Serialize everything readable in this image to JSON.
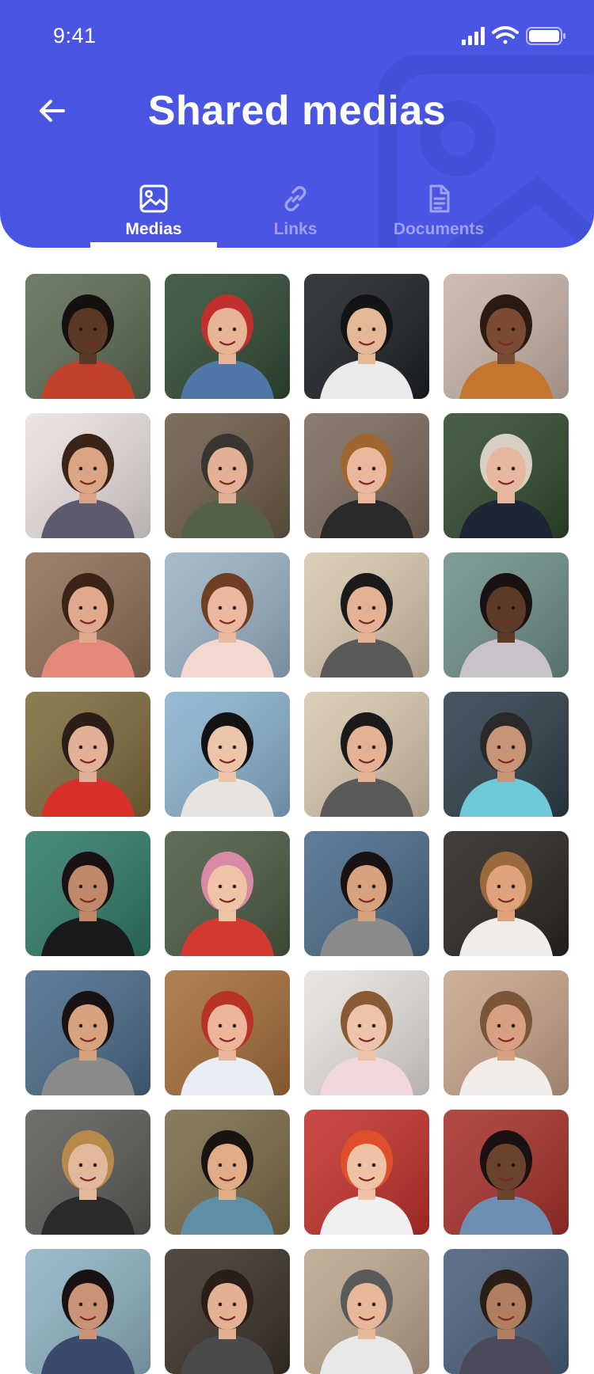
{
  "status_bar": {
    "time": "9:41",
    "icons": [
      "signal-icon",
      "wifi-icon",
      "battery-icon"
    ]
  },
  "header": {
    "title": "Shared medias",
    "back_icon": "arrow-left-icon",
    "background": "#4a55e3"
  },
  "tabs": [
    {
      "label": "Medias",
      "icon": "image-icon",
      "active": true
    },
    {
      "label": "Links",
      "icon": "link-icon",
      "active": false
    },
    {
      "label": "Documents",
      "icon": "document-icon",
      "active": false
    }
  ],
  "media_grid": {
    "columns": 4,
    "items": [
      {
        "bg": "#5c6b52",
        "skin": "#5a3a26",
        "top": "#c2412d",
        "hair": "#151010"
      },
      {
        "bg": "#2f4a33",
        "skin": "#e6b596",
        "top": "#4f78a8",
        "hair": "#bf2f2b"
      },
      {
        "bg": "#1c1f25",
        "skin": "#e4b896",
        "top": "#eaeaea",
        "hair": "#141414"
      },
      {
        "bg": "#c9b4a8",
        "skin": "#7a4a33",
        "top": "#c2762e",
        "hair": "#2a1a12"
      },
      {
        "bg": "#e9e1df",
        "skin": "#d9a585",
        "top": "#5c5a6e",
        "hair": "#3a2418"
      },
      {
        "bg": "#6c5a48",
        "skin": "#e1b095",
        "top": "#556049",
        "hair": "#3a3530"
      },
      {
        "bg": "#7c6a5c",
        "skin": "#eab79d",
        "top": "#2a2a2a",
        "hair": "#a0662f"
      },
      {
        "bg": "#2f4a2c",
        "skin": "#e5b79f",
        "top": "#1e2636",
        "hair": "#d9cfc0"
      },
      {
        "bg": "#8e6f57",
        "skin": "#e0a98e",
        "top": "#e58a7a",
        "hair": "#3a2418"
      },
      {
        "bg": "#9bb2c4",
        "skin": "#eab89f",
        "top": "#f3d8d0",
        "hair": "#6e3f22"
      },
      {
        "bg": "#d8c7ae",
        "skin": "#e3b194",
        "top": "#5a5a5a",
        "hair": "#1a1a1a"
      },
      {
        "bg": "#6d8f87",
        "skin": "#5c3a28",
        "top": "#c9c3c9",
        "hair": "#1a1212"
      },
      {
        "bg": "#7d6a3c",
        "skin": "#e2b097",
        "top": "#d9302a",
        "hair": "#2a1e16"
      },
      {
        "bg": "#8ab2cf",
        "skin": "#ecc4a8",
        "top": "#e7e4df",
        "hair": "#121212"
      },
      {
        "bg": "#d8c7ae",
        "skin": "#e3b194",
        "top": "#5a5a5a",
        "hair": "#1a1a1a"
      },
      {
        "bg": "#2d3e4a",
        "skin": "#c79478",
        "top": "#6fc8d8",
        "hair": "#2a2a2a"
      },
      {
        "bg": "#2f7a67",
        "skin": "#c08a6a",
        "top": "#1a1a1a",
        "hair": "#1a1212"
      },
      {
        "bg": "#4a5a42",
        "skin": "#efc3a5",
        "top": "#d23a31",
        "hair": "#d98aa6"
      },
      {
        "bg": "#4a6a8a",
        "skin": "#d9a27f",
        "top": "#8a8a8a",
        "hair": "#1a1212"
      },
      {
        "bg": "#2a241f",
        "skin": "#e0a27d",
        "top": "#f0ede8",
        "hair": "#9a6a3c"
      },
      {
        "bg": "#4a6a8a",
        "skin": "#d9a27f",
        "top": "#8a8a8a",
        "hair": "#1a1212"
      },
      {
        "bg": "#a56d3a",
        "skin": "#eab599",
        "top": "#e8eef3",
        "hair": "#b83226"
      },
      {
        "bg": "#e7e2dd",
        "skin": "#edc3ab",
        "top": "#f0d7d9",
        "hair": "#8a5a35"
      },
      {
        "bg": "#c8a48a",
        "skin": "#d8a083",
        "top": "#f2ece8",
        "hair": "#7a5538"
      },
      {
        "bg": "#5a5a55",
        "skin": "#e3b89a",
        "top": "#2a2a2a",
        "hair": "#b8894a"
      },
      {
        "bg": "#7a6a48",
        "skin": "#e0ac87",
        "top": "#5f8fa4",
        "hair": "#1a1410"
      },
      {
        "bg": "#c2302a",
        "skin": "#f0c2a5",
        "top": "#f0f0f0",
        "hair": "#e04f2c"
      },
      {
        "bg": "#a8302a",
        "skin": "#6a422e",
        "top": "#6e8eb4",
        "hair": "#1a1212"
      },
      {
        "bg": "#8eb3c2",
        "skin": "#c89475",
        "top": "#3a4a6a",
        "hair": "#1a1212"
      },
      {
        "bg": "#3a3028",
        "skin": "#e4b093",
        "top": "#4a4a4a",
        "hair": "#2a1e16"
      },
      {
        "bg": "#bba68e",
        "skin": "#e7b79a",
        "top": "#e8e8e8",
        "hair": "#5a5a5a"
      },
      {
        "bg": "#4a5e7a",
        "skin": "#b07e60",
        "top": "#4a4a5a",
        "hair": "#2a1e16"
      }
    ]
  }
}
